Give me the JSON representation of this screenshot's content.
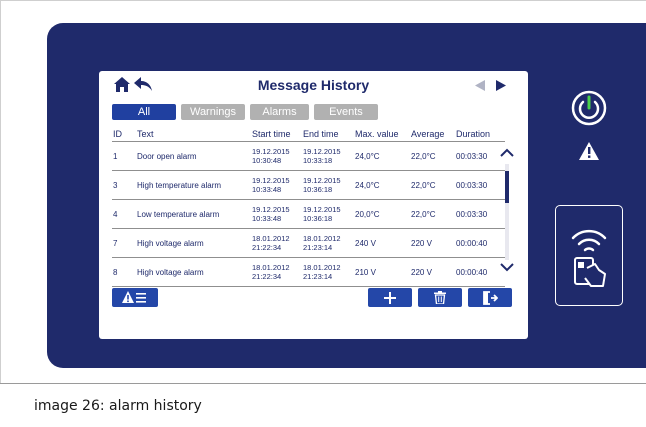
{
  "caption": "image 26: alarm history",
  "header": {
    "title": "Message History"
  },
  "tabs": [
    {
      "label": "All",
      "active": true
    },
    {
      "label": "Warnings",
      "active": false
    },
    {
      "label": "Alarms",
      "active": false
    },
    {
      "label": "Events",
      "active": false
    }
  ],
  "columns": [
    "ID",
    "Text",
    "Start time",
    "End time",
    "Max. value",
    "Average",
    "Duration"
  ],
  "rows": [
    {
      "id": "1",
      "text": "Door open alarm",
      "start_date": "19.12.2015",
      "start_time": "10:30:48",
      "end_date": "19.12.2015",
      "end_time": "10:33:18",
      "max": "24,0°C",
      "avg": "22,0°C",
      "duration": "00:03:30"
    },
    {
      "id": "3",
      "text": "High temperature alarm",
      "start_date": "19.12.2015",
      "start_time": "10:33:48",
      "end_date": "19.12.2015",
      "end_time": "10:36:18",
      "max": "24,0°C",
      "avg": "22,0°C",
      "duration": "00:03:30"
    },
    {
      "id": "4",
      "text": "Low temperature alarm",
      "start_date": "19.12.2015",
      "start_time": "10:33:48",
      "end_date": "19.12.2015",
      "end_time": "10:36:18",
      "max": "20,0°C",
      "avg": "22,0°C",
      "duration": "00:03:30"
    },
    {
      "id": "7",
      "text": "High voltage alarm",
      "start_date": "18.01.2012",
      "start_time": "21:22:34",
      "end_date": "18.01.2012",
      "end_time": "21:23:14",
      "max": "240 V",
      "avg": "220 V",
      "duration": "00:00:40"
    },
    {
      "id": "8",
      "text": "High voltage alarm",
      "start_date": "18.01.2012",
      "start_time": "21:22:34",
      "end_date": "18.01.2012",
      "end_time": "21:23:14",
      "max": "210 V",
      "avg": "220 V",
      "duration": "00:00:40"
    }
  ],
  "colors": {
    "device": "#1f2a6b",
    "accent": "#2447a8",
    "tab_inactive": "#b1b1b1"
  },
  "icons": [
    "home-icon",
    "back-icon",
    "prev-page-icon",
    "next-page-icon",
    "alarm-filter-icon",
    "add-icon",
    "delete-icon",
    "export-icon",
    "power-icon",
    "warning-icon",
    "rfid-card-icon"
  ]
}
